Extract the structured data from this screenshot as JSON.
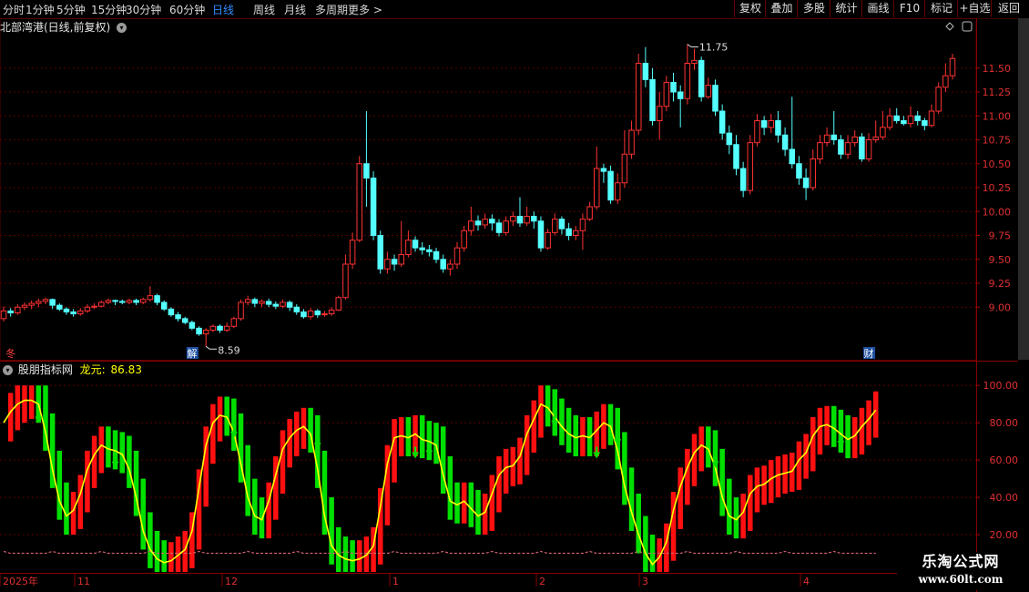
{
  "toolbar": {
    "periods": [
      "分时",
      "1分钟",
      "5分钟",
      "15分钟",
      "30分钟",
      "60分钟",
      "日线",
      "周线",
      "月线",
      "多周期",
      "更多 >"
    ],
    "active_period": "日线",
    "right_buttons": [
      "复权",
      "叠加",
      "多股",
      "统计",
      "画线",
      "F10",
      "标记",
      "+自选",
      "返回"
    ]
  },
  "main_header": {
    "title": "北部湾港(日线,前复权)"
  },
  "indicator_header": {
    "name": "股朋指标网",
    "series_label": "龙元:",
    "series_value": "86.83"
  },
  "price_axis": {
    "ticks": [
      "11.50",
      "11.25",
      "11.00",
      "10.75",
      "10.50",
      "10.25",
      "10.00",
      "9.75",
      "9.50",
      "9.25",
      "9.00"
    ]
  },
  "indicator_axis": {
    "ticks": [
      "100.00",
      "80.00",
      "60.00",
      "40.00",
      "20.00"
    ]
  },
  "annotations": {
    "high_label": "11.75",
    "low_label": "8.59",
    "marker_left": "冬",
    "marker_mid": "解",
    "marker_right": "财"
  },
  "time_axis": {
    "labels": [
      "2025年",
      "11",
      "12",
      "1",
      "2",
      "3",
      "4"
    ]
  },
  "watermark": {
    "line1": "乐淘公式网",
    "line2": "www.60lt.com"
  },
  "colors": {
    "up": "#ff3232",
    "down": "#54ffff",
    "ind_up": "#ff1010",
    "ind_down": "#00e000",
    "curve": "#ffff00",
    "axis_up": "#e03030",
    "grid": "#5a0000",
    "toolbar_active": "#2f8cff"
  },
  "chart_data": {
    "type": "candlestick",
    "candles": [
      [
        8.88,
        8.96,
        9.01,
        8.85
      ],
      [
        8.96,
        8.94,
        8.99,
        8.9
      ],
      [
        8.94,
        9.0,
        9.03,
        8.92
      ],
      [
        9.0,
        9.02,
        9.05,
        8.97
      ],
      [
        9.02,
        9.04,
        9.07,
        8.98
      ],
      [
        9.04,
        9.06,
        9.09,
        9.0
      ],
      [
        9.06,
        9.08,
        9.1,
        9.03
      ],
      [
        9.08,
        9.02,
        9.09,
        8.98
      ],
      [
        9.02,
        8.98,
        9.04,
        8.96
      ],
      [
        8.98,
        8.95,
        9.0,
        8.92
      ],
      [
        8.95,
        8.93,
        8.98,
        8.9
      ],
      [
        8.93,
        8.96,
        8.99,
        8.91
      ],
      [
        8.96,
        9.0,
        9.03,
        8.94
      ],
      [
        9.0,
        9.01,
        9.04,
        8.98
      ],
      [
        9.01,
        9.05,
        9.07,
        9.0
      ],
      [
        9.05,
        9.07,
        9.09,
        9.03
      ],
      [
        9.07,
        9.06,
        9.08,
        9.02
      ],
      [
        9.06,
        9.05,
        9.08,
        9.03
      ],
      [
        9.05,
        9.07,
        9.09,
        9.03
      ],
      [
        9.07,
        9.05,
        9.09,
        9.02
      ],
      [
        9.05,
        9.08,
        9.1,
        9.03
      ],
      [
        9.08,
        9.12,
        9.22,
        9.06
      ],
      [
        9.12,
        9.05,
        9.14,
        9.02
      ],
      [
        9.05,
        8.98,
        9.07,
        8.96
      ],
      [
        8.98,
        8.92,
        9.0,
        8.9
      ],
      [
        8.92,
        8.88,
        8.95,
        8.85
      ],
      [
        8.88,
        8.84,
        8.9,
        8.82
      ],
      [
        8.84,
        8.78,
        8.86,
        8.76
      ],
      [
        8.78,
        8.72,
        8.8,
        8.7
      ],
      [
        8.72,
        8.76,
        8.78,
        8.59
      ],
      [
        8.76,
        8.8,
        8.82,
        8.74
      ],
      [
        8.8,
        8.76,
        8.82,
        8.73
      ],
      [
        8.76,
        8.8,
        8.84,
        8.74
      ],
      [
        8.8,
        8.88,
        8.9,
        8.78
      ],
      [
        8.88,
        9.05,
        9.08,
        8.86
      ],
      [
        9.05,
        9.08,
        9.12,
        9.02
      ],
      [
        9.08,
        9.04,
        9.1,
        9.0
      ],
      [
        9.04,
        9.06,
        9.08,
        9.0
      ],
      [
        9.06,
        9.03,
        9.09,
        9.0
      ],
      [
        9.03,
        9.01,
        9.06,
        8.98
      ],
      [
        9.01,
        9.05,
        9.08,
        8.99
      ],
      [
        9.05,
        9.0,
        9.07,
        8.96
      ],
      [
        9.0,
        8.95,
        9.03,
        8.92
      ],
      [
        8.95,
        8.9,
        8.98,
        8.88
      ],
      [
        8.9,
        8.96,
        8.99,
        8.87
      ],
      [
        8.96,
        8.92,
        8.98,
        8.89
      ],
      [
        8.92,
        8.93,
        8.96,
        8.9
      ],
      [
        8.93,
        8.97,
        9.0,
        8.91
      ],
      [
        8.97,
        9.1,
        9.12,
        8.96
      ],
      [
        9.1,
        9.45,
        9.55,
        9.08
      ],
      [
        9.45,
        9.7,
        9.78,
        9.4
      ],
      [
        9.7,
        10.5,
        10.58,
        9.68
      ],
      [
        10.5,
        10.35,
        11.05,
        10.05
      ],
      [
        10.35,
        9.75,
        10.42,
        9.7
      ],
      [
        9.75,
        9.4,
        9.8,
        9.35
      ],
      [
        9.4,
        9.5,
        9.58,
        9.35
      ],
      [
        9.5,
        9.45,
        9.55,
        9.38
      ],
      [
        9.45,
        9.55,
        9.9,
        9.42
      ],
      [
        9.55,
        9.7,
        9.8,
        9.52
      ],
      [
        9.7,
        9.62,
        9.74,
        9.58
      ],
      [
        9.62,
        9.6,
        9.68,
        9.55
      ],
      [
        9.6,
        9.58,
        9.65,
        9.53
      ],
      [
        9.58,
        9.5,
        9.62,
        9.46
      ],
      [
        9.5,
        9.4,
        9.55,
        9.36
      ],
      [
        9.4,
        9.45,
        9.5,
        9.33
      ],
      [
        9.45,
        9.62,
        9.68,
        9.4
      ],
      [
        9.62,
        9.8,
        9.85,
        9.58
      ],
      [
        9.8,
        9.9,
        10.05,
        9.75
      ],
      [
        9.9,
        9.86,
        9.96,
        9.8
      ],
      [
        9.86,
        9.92,
        9.98,
        9.82
      ],
      [
        9.92,
        9.88,
        9.97,
        9.8
      ],
      [
        9.88,
        9.78,
        9.92,
        9.74
      ],
      [
        9.78,
        9.9,
        9.95,
        9.75
      ],
      [
        9.9,
        9.95,
        10.0,
        9.85
      ],
      [
        9.95,
        9.88,
        10.15,
        9.84
      ],
      [
        9.88,
        9.95,
        10.05,
        9.85
      ],
      [
        9.95,
        9.9,
        10.0,
        9.82
      ],
      [
        9.9,
        9.62,
        9.95,
        9.58
      ],
      [
        9.62,
        9.78,
        9.82,
        9.6
      ],
      [
        9.78,
        9.92,
        9.98,
        9.75
      ],
      [
        9.92,
        9.82,
        9.95,
        9.76
      ],
      [
        9.82,
        9.75,
        9.88,
        9.7
      ],
      [
        9.75,
        9.8,
        9.85,
        9.7
      ],
      [
        9.8,
        9.92,
        9.98,
        9.6
      ],
      [
        9.92,
        10.05,
        10.1,
        9.9
      ],
      [
        10.05,
        10.45,
        10.68,
        10.02
      ],
      [
        10.45,
        10.42,
        10.5,
        10.3
      ],
      [
        10.42,
        10.12,
        10.48,
        10.08
      ],
      [
        10.12,
        10.3,
        10.4,
        10.08
      ],
      [
        10.3,
        10.6,
        10.85,
        10.25
      ],
      [
        10.6,
        10.85,
        10.95,
        10.55
      ],
      [
        10.85,
        11.55,
        11.65,
        10.8
      ],
      [
        11.55,
        11.38,
        11.72,
        11.3
      ],
      [
        11.38,
        10.95,
        11.5,
        10.9
      ],
      [
        10.95,
        11.1,
        11.25,
        10.75
      ],
      [
        11.1,
        11.35,
        11.42,
        11.05
      ],
      [
        11.35,
        11.25,
        11.45,
        11.15
      ],
      [
        11.25,
        11.18,
        11.32,
        10.88
      ],
      [
        11.18,
        11.55,
        11.75,
        11.12
      ],
      [
        11.55,
        11.58,
        11.7,
        11.48
      ],
      [
        11.58,
        11.2,
        11.62,
        11.15
      ],
      [
        11.2,
        11.32,
        11.4,
        11.18
      ],
      [
        11.32,
        11.05,
        11.38,
        11.0
      ],
      [
        11.05,
        10.82,
        11.12,
        10.75
      ],
      [
        10.82,
        10.7,
        10.9,
        10.6
      ],
      [
        10.7,
        10.45,
        10.8,
        10.38
      ],
      [
        10.45,
        10.22,
        10.52,
        10.15
      ],
      [
        10.22,
        10.72,
        10.8,
        10.18
      ],
      [
        10.72,
        10.95,
        11.02,
        10.68
      ],
      [
        10.95,
        10.88,
        11.0,
        10.8
      ],
      [
        10.88,
        10.95,
        11.02,
        10.82
      ],
      [
        10.95,
        10.8,
        11.05,
        10.72
      ],
      [
        10.8,
        10.65,
        10.88,
        10.58
      ],
      [
        10.65,
        10.5,
        11.2,
        10.45
      ],
      [
        10.5,
        10.35,
        10.58,
        10.28
      ],
      [
        10.35,
        10.25,
        10.45,
        10.12
      ],
      [
        10.25,
        10.55,
        10.65,
        10.22
      ],
      [
        10.55,
        10.72,
        10.8,
        10.5
      ],
      [
        10.72,
        10.8,
        10.88,
        10.68
      ],
      [
        10.8,
        10.75,
        11.05,
        10.7
      ],
      [
        10.75,
        10.6,
        10.8,
        10.55
      ],
      [
        10.6,
        10.72,
        10.8,
        10.55
      ],
      [
        10.72,
        10.78,
        10.85,
        10.68
      ],
      [
        10.78,
        10.55,
        10.82,
        10.52
      ],
      [
        10.55,
        10.75,
        10.82,
        10.52
      ],
      [
        10.75,
        10.78,
        10.95,
        10.72
      ],
      [
        10.78,
        10.88,
        11.05,
        10.75
      ],
      [
        10.88,
        11.0,
        11.08,
        10.85
      ],
      [
        11.0,
        10.95,
        11.08,
        10.92
      ],
      [
        10.95,
        10.92,
        11.0,
        10.9
      ],
      [
        10.92,
        11.0,
        11.1,
        10.88
      ],
      [
        11.0,
        10.95,
        11.05,
        10.9
      ],
      [
        10.95,
        10.9,
        10.98,
        10.85
      ],
      [
        10.9,
        11.05,
        11.12,
        10.88
      ],
      [
        11.05,
        11.3,
        11.35,
        11.02
      ],
      [
        11.3,
        11.42,
        11.55,
        11.25
      ],
      [
        11.42,
        11.6,
        11.65,
        11.38
      ]
    ],
    "indicator": {
      "name": "龙元",
      "last_value": 86.83,
      "curve": [
        80,
        86,
        90,
        92,
        92,
        90,
        75,
        55,
        38,
        30,
        33,
        42,
        55,
        63,
        68,
        66,
        65,
        63,
        55,
        40,
        22,
        12,
        7,
        5,
        6,
        9,
        12,
        22,
        45,
        68,
        80,
        84,
        83,
        75,
        58,
        40,
        30,
        28,
        38,
        52,
        66,
        72,
        76,
        78,
        74,
        55,
        30,
        14,
        9,
        7,
        6,
        7,
        9,
        14,
        35,
        58,
        72,
        73,
        72,
        74,
        71,
        70,
        68,
        52,
        38,
        36,
        38,
        34,
        30,
        32,
        42,
        52,
        56,
        57,
        62,
        74,
        82,
        90,
        88,
        83,
        78,
        74,
        72,
        73,
        72,
        76,
        80,
        78,
        65,
        46,
        32,
        20,
        10,
        4,
        8,
        16,
        33,
        46,
        56,
        64,
        68,
        66,
        56,
        40,
        30,
        28,
        32,
        42,
        46,
        47,
        50,
        52,
        53,
        54,
        60,
        64,
        73,
        78,
        79,
        77,
        74,
        71,
        73,
        78,
        82,
        86.83
      ],
      "ylim": [
        0,
        105
      ]
    },
    "price_ylim": [
      8.45,
      11.85
    ]
  }
}
